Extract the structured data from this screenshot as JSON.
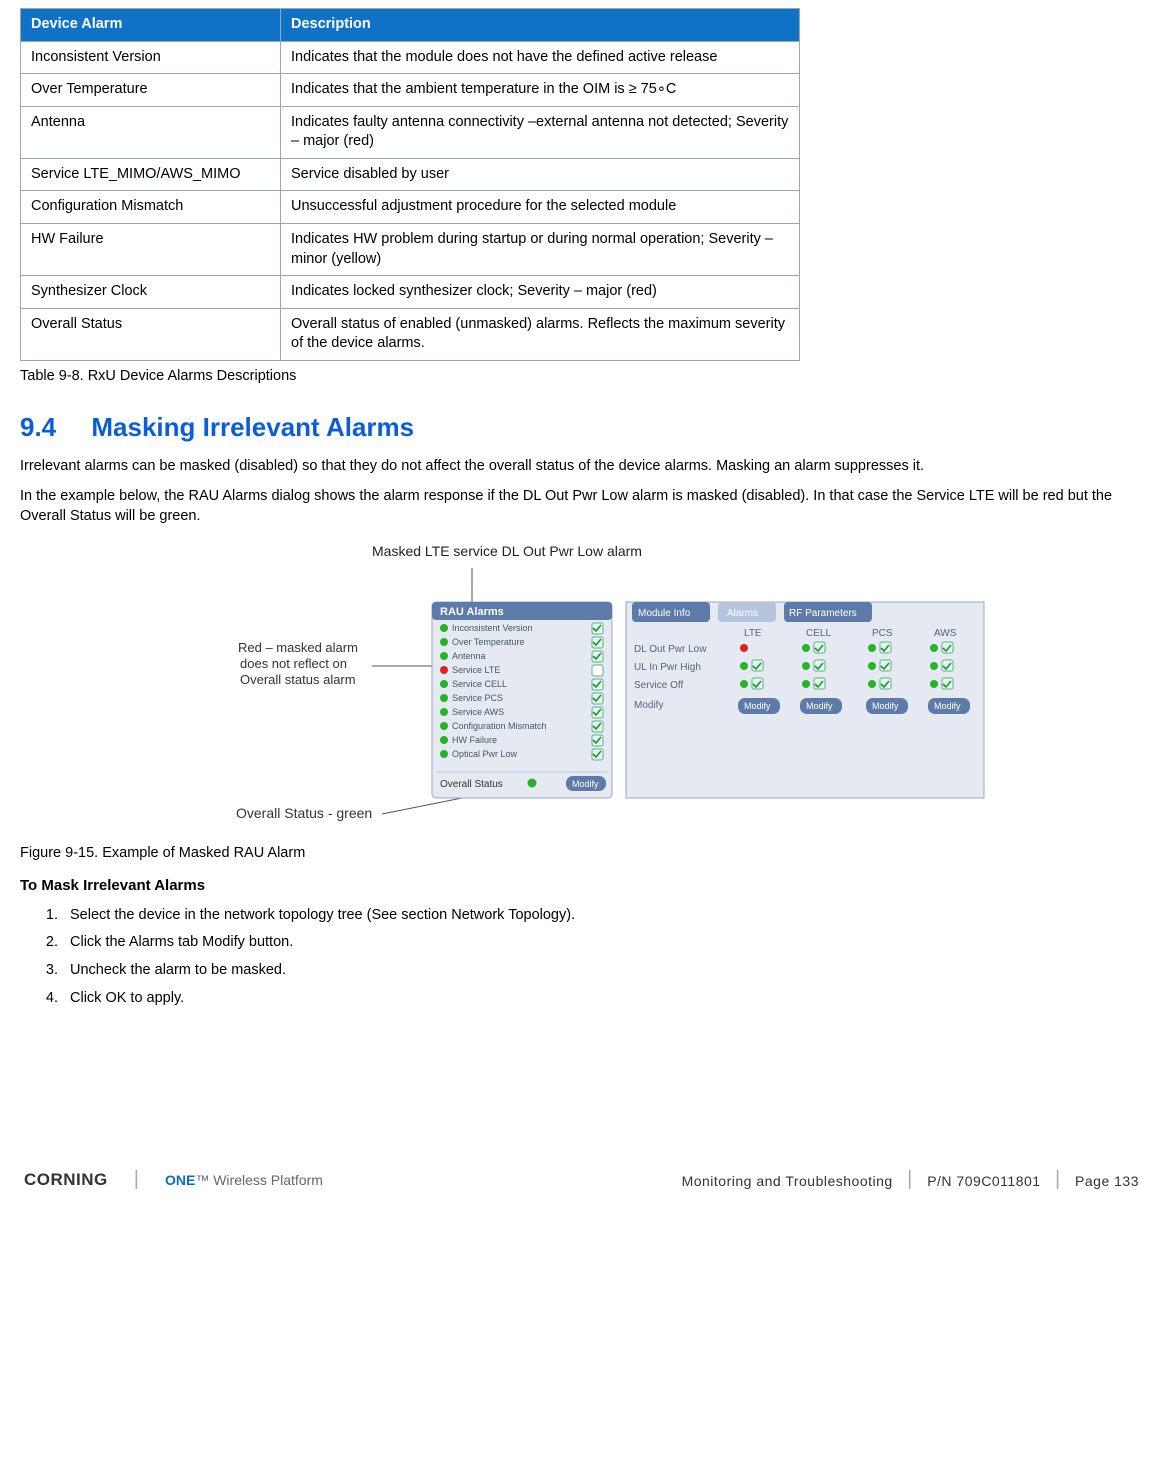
{
  "table": {
    "headers": [
      "Device Alarm",
      "Description"
    ],
    "rows": [
      [
        "Inconsistent Version",
        "Indicates that the module does not have the defined active release"
      ],
      [
        "Over Temperature",
        "Indicates that the ambient temperature in the OIM is ≥ 75∘C"
      ],
      [
        "Antenna",
        "Indicates faulty antenna connectivity –external antenna not detected;   Severity – major (red)"
      ],
      [
        "Service LTE_MIMO/AWS_MIMO",
        "Service disabled by user"
      ],
      [
        "Configuration Mismatch",
        "Unsuccessful adjustment procedure for the selected module"
      ],
      [
        "HW Failure",
        "Indicates HW problem during startup or during normal operation; Severity – minor (yellow)"
      ],
      [
        "Synthesizer Clock",
        "Indicates locked synthesizer clock; Severity – major (red)"
      ],
      [
        "Overall Status",
        "Overall status of enabled (unmasked) alarms. Reflects the maximum severity of the device alarms."
      ]
    ]
  },
  "table_caption": "Table 9-8. RxU Device Alarms Descriptions",
  "heading_no": "9.4",
  "heading_text": "Masking Irrelevant Alarms",
  "para1": "Irrelevant alarms can be masked (disabled) so that they do not affect the overall status of the device alarms. Masking an alarm suppresses it.",
  "para2": "In the example below, the RAU Alarms dialog shows the alarm response if the DL Out Pwr Low alarm is masked (disabled). In that case the Service LTE will be red but the Overall Status will be green.",
  "fig": {
    "label_top": "Masked LTE service DL Out Pwr Low alarm",
    "label_left1": "Red – masked alarm",
    "label_left2": "does not reflect on",
    "label_left3": "Overall status alarm",
    "label_bottom": "Overall Status - green",
    "alarms_title": "RAU Alarms",
    "alarm_items": [
      "Inconsistent Version",
      "Over Temperature",
      "Antenna",
      "Service LTE",
      "Service CELL",
      "Service PCS",
      "Service AWS",
      "Configuration Mismatch",
      "HW Failure",
      "Optical Pwr Low"
    ],
    "overall_status": "Overall Status",
    "modify": "Modify",
    "tab1": "Module Info",
    "tab2": "Alarms",
    "tab3": "RF Parameters",
    "row1": "DL Out Pwr Low",
    "row2": "UL In Pwr High",
    "row3": "Service Off",
    "row4": "Modify",
    "col_lte": "LTE",
    "col_cell": "CELL",
    "col_pcs": "PCS",
    "col_aws": "AWS"
  },
  "fig_caption": "Figure 9-15. Example of Masked RAU Alarm",
  "subhead": "To Mask Irrelevant Alarms",
  "steps": [
    "Select the device in the network topology tree (See section Network Topology).",
    "Click the Alarms tab Modify button.",
    "Uncheck the alarm to be masked.",
    "Click OK to apply."
  ],
  "footer": {
    "brand1": "CORNING",
    "brand2_one": "ONE",
    "brand2_rest": "™ Wireless Platform",
    "chapter": "Monitoring and Troubleshooting",
    "pn": "P/N 709C011801",
    "page": "Page 133"
  }
}
